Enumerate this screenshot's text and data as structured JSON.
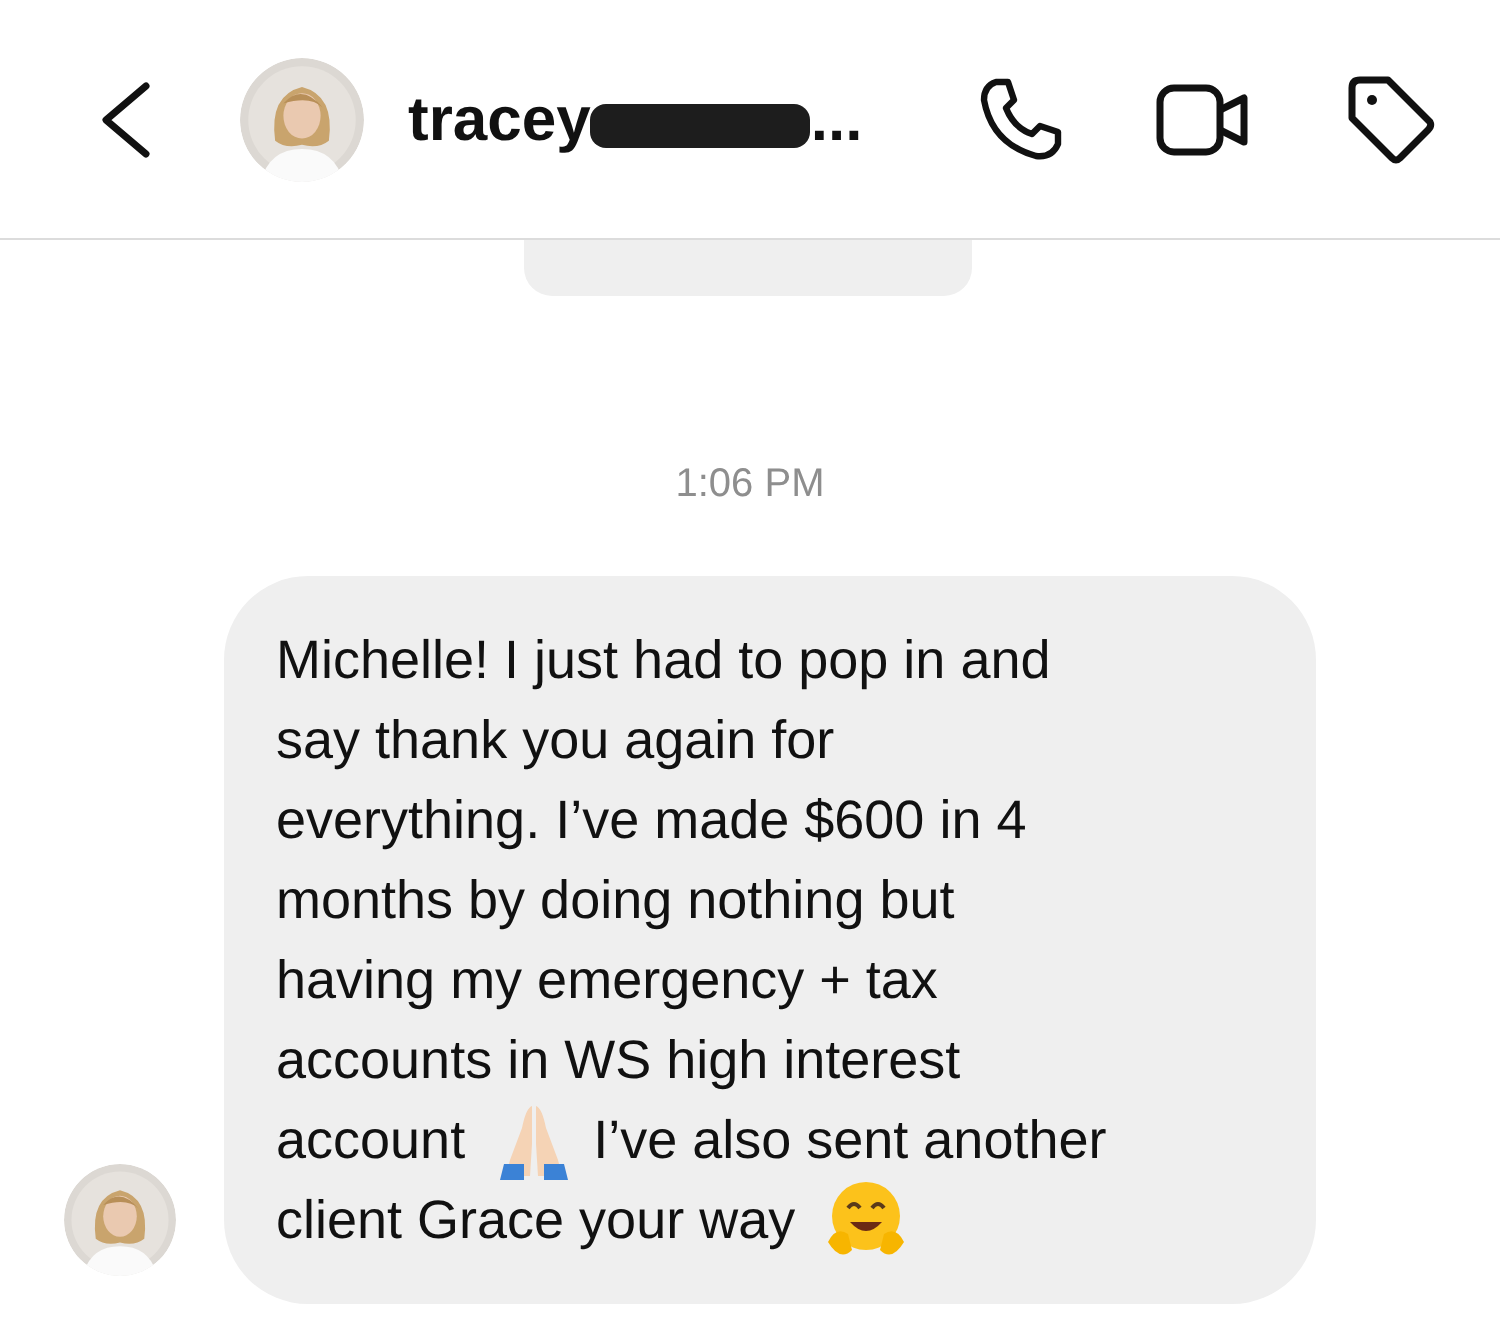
{
  "header": {
    "title": "tracey",
    "redacted": true,
    "truncation": "..."
  },
  "timestamp": "1:06 PM",
  "message": {
    "lines": [
      [
        {
          "kind": "text",
          "text": "Michelle! I just had to pop in and"
        }
      ],
      [
        {
          "kind": "text",
          "text": "say thank you again for"
        }
      ],
      [
        {
          "kind": "text",
          "text": "everything. I’ve made $600 in 4"
        }
      ],
      [
        {
          "kind": "text",
          "text": "months by doing nothing but"
        }
      ],
      [
        {
          "kind": "text",
          "text": "having my emergency + tax"
        }
      ],
      [
        {
          "kind": "text",
          "text": "accounts in WS high interest"
        }
      ],
      [
        {
          "kind": "text",
          "text": "account"
        },
        {
          "kind": "praying-hands"
        },
        {
          "kind": "text",
          "text": "I’ve also sent another"
        }
      ],
      [
        {
          "kind": "text",
          "text": "client Grace your way"
        },
        {
          "kind": "hugging-face"
        }
      ]
    ]
  }
}
